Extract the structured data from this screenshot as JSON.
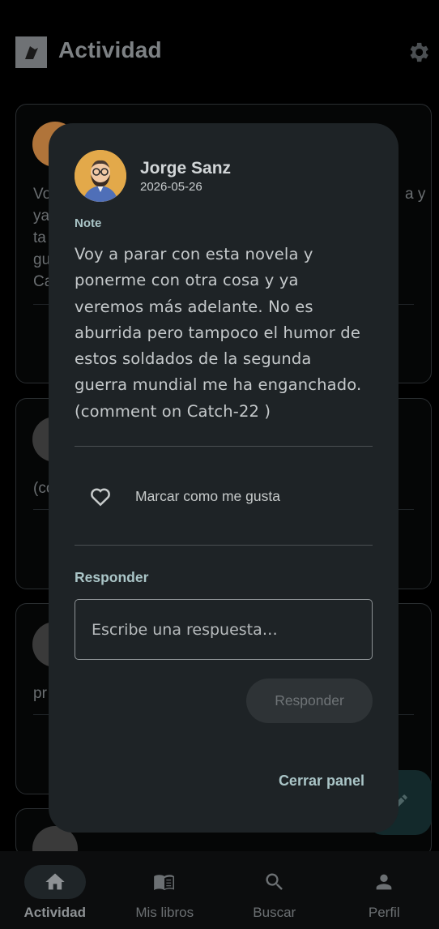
{
  "app": {
    "title": "Actividad",
    "logo_icon": "reader-logo-icon",
    "settings_icon": "gear-icon"
  },
  "feed": {
    "cards": [
      {
        "text_lines": [
          "Vo",
          "ya",
          "ta",
          "gu",
          "Ca"
        ],
        "text_right": "a y"
      },
      {
        "text_lines": [
          "(co"
        ]
      },
      {
        "text_lines": [
          "pr"
        ]
      }
    ]
  },
  "dialog": {
    "author": "Jorge Sanz",
    "date": "2026-05-26",
    "kind": "Note",
    "body_lines": [
      "Voy a parar con esta novela y",
      "ponerme con otra cosa y ya",
      "veremos más adelante. No es",
      "aburrida pero tampoco el humor de",
      "estos soldados de la segunda",
      "guerra mundial me ha enganchado.",
      "(comment on Catch-22 )"
    ],
    "like_label": "Marcar como me gusta",
    "reply_heading": "Responder",
    "reply_placeholder": "Escribe una respuesta…",
    "reply_button": "Responder",
    "close_button": "Cerrar panel"
  },
  "nav": {
    "items": [
      {
        "label": "Actividad",
        "icon": "home-icon",
        "active": true
      },
      {
        "label": "Mis libros",
        "icon": "book-icon",
        "active": false
      },
      {
        "label": "Buscar",
        "icon": "search-icon",
        "active": false
      },
      {
        "label": "Perfil",
        "icon": "person-icon",
        "active": false
      }
    ]
  },
  "colors": {
    "background": "#000000",
    "dialog": "#1e2326",
    "accent": "#aac5c7",
    "avatar": "#e3a94a"
  }
}
